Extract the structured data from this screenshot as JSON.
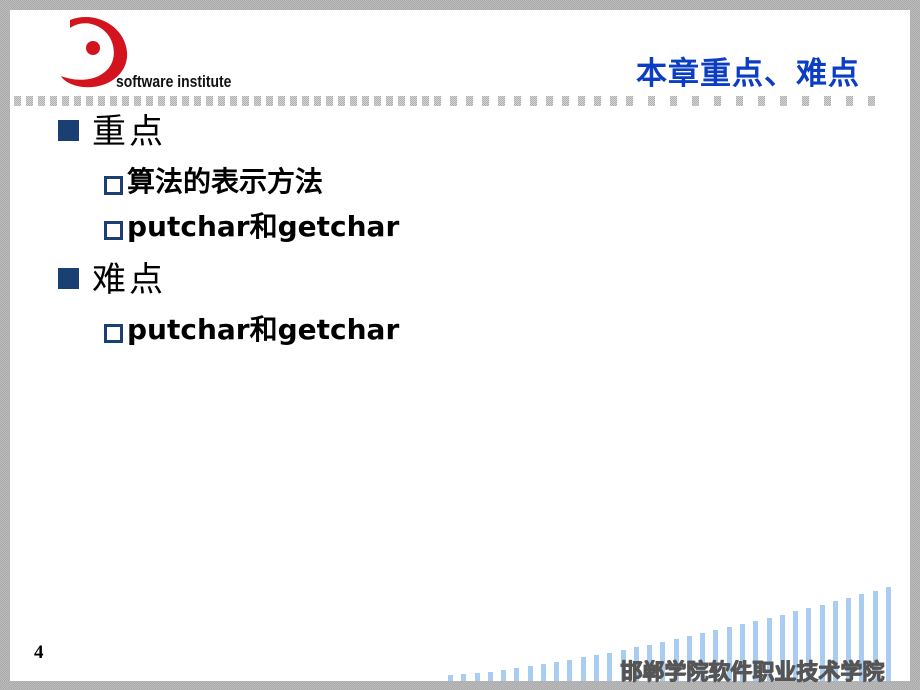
{
  "header": {
    "logo_text": "software institute",
    "logo_icon": "crescent-dot-logo",
    "title": "本章重点、难点"
  },
  "colors": {
    "title": "#0b3ec4",
    "bullet": "#1a3f73",
    "logo_red": "#d3131e",
    "footer_bars": "#a9cdf2",
    "footer_text": "#555555",
    "frame": "#a9a9a9"
  },
  "content": {
    "sections": [
      {
        "label": "重点",
        "bullet_icon": "filled-square-bullet",
        "items": [
          {
            "label": "算法的表示方法",
            "bullet_icon": "hollow-square-bullet"
          },
          {
            "label": "putchar和getchar",
            "bullet_icon": "hollow-square-bullet"
          }
        ]
      },
      {
        "label": "难点",
        "bullet_icon": "filled-square-bullet",
        "items": [
          {
            "label": "putchar和getchar",
            "bullet_icon": "hollow-square-bullet"
          }
        ]
      }
    ]
  },
  "footer": {
    "page_number": "4",
    "institution": "邯郸学院软件职业技术学院"
  }
}
